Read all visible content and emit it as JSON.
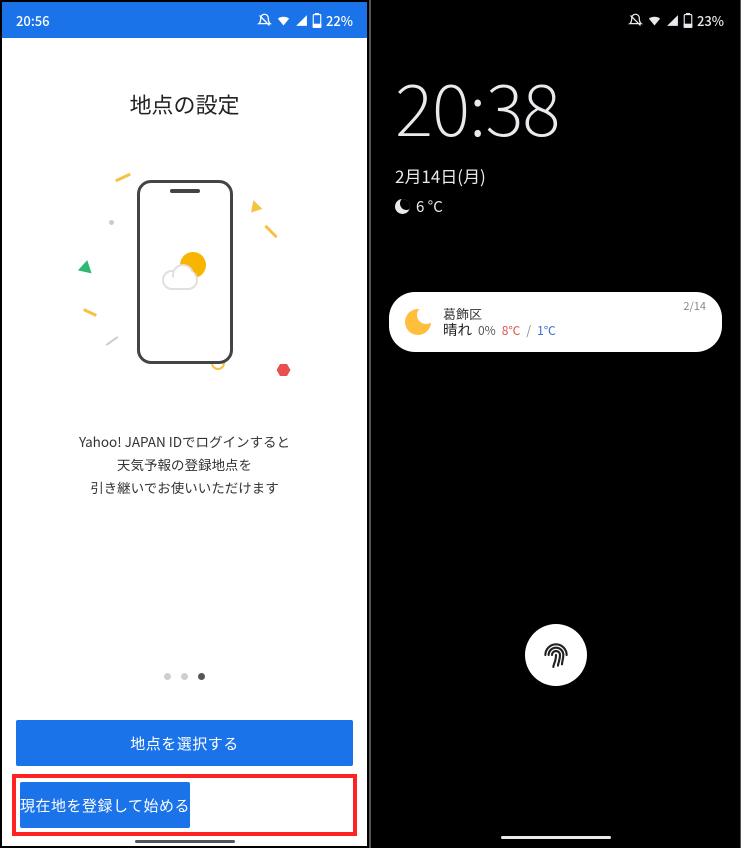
{
  "left": {
    "status": {
      "time": "20:56",
      "battery": "22%"
    },
    "heading": "地点の設定",
    "desc_line1": "Yahoo! JAPAN IDでログインすると",
    "desc_line2": "天気予報の登録地点を",
    "desc_line3": "引き継いでお使いいただけます",
    "pager": {
      "count": 3,
      "active_index": 2
    },
    "buttons": {
      "select_location": "地点を選択する",
      "register_current": "現在地を登録して始める"
    }
  },
  "right": {
    "status": {
      "battery": "23%"
    },
    "lock": {
      "time": "20:38",
      "date": "2月14日(月)",
      "temp": "6 °C"
    },
    "notification": {
      "location": "葛飾区",
      "condition": "晴れ",
      "precip": "0%",
      "high": "8℃",
      "low": "1℃",
      "date": "2/14"
    }
  }
}
